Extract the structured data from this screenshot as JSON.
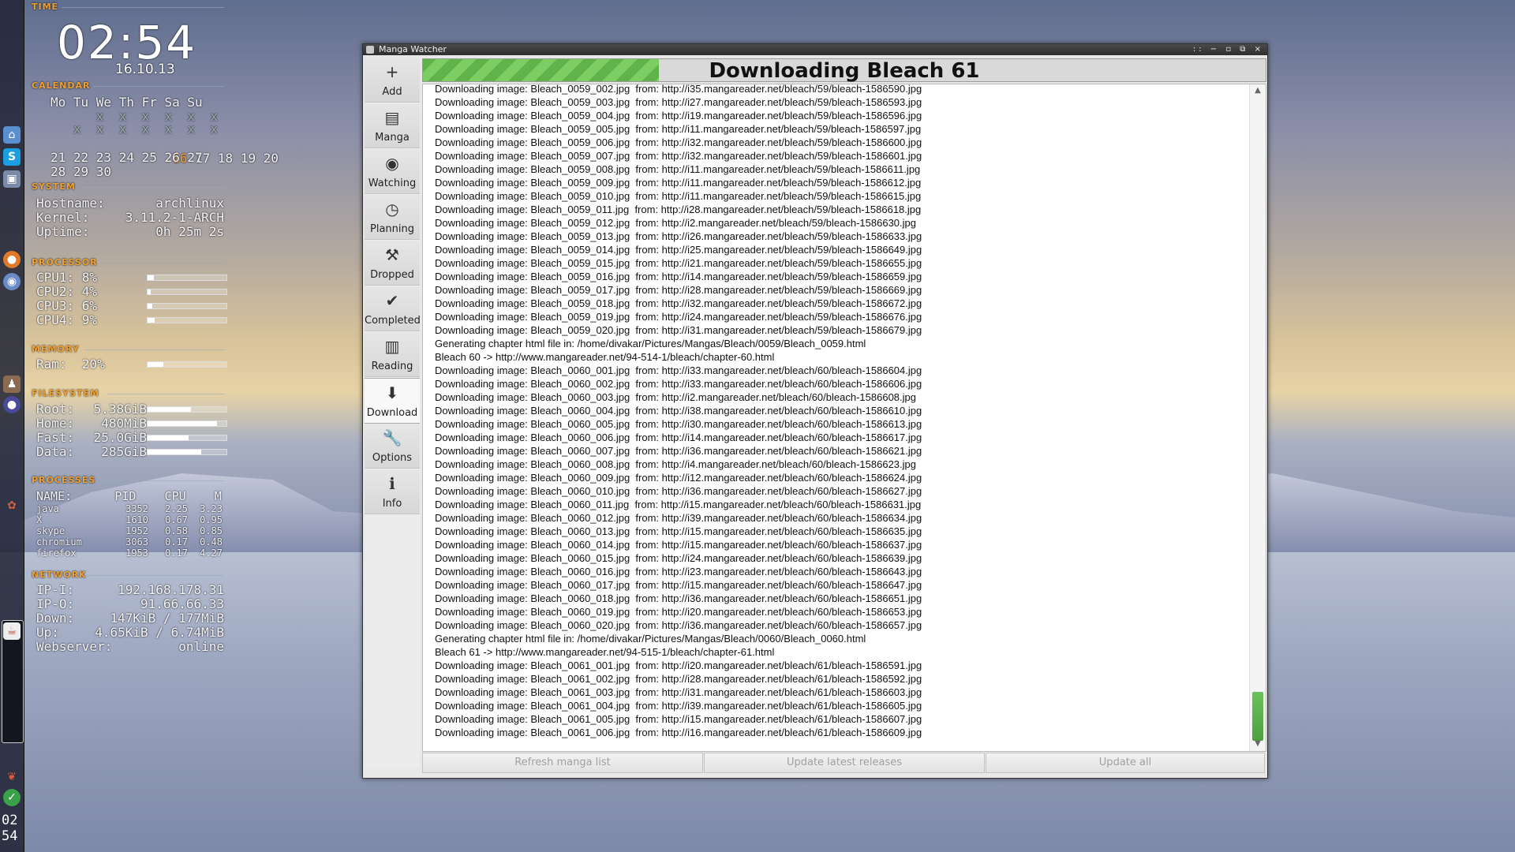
{
  "conky": {
    "time_title": "TIME",
    "clock": "02:54",
    "date": "16.10.13",
    "calendar_title": "CALENDAR",
    "calendar_header": "Mo Tu We Th Fr Sa Su",
    "calendar_rows": [
      "             16 17 18 19 20",
      "21 22 23 24 25 26 27",
      "28 29 30"
    ],
    "calendar_today": "16",
    "system_title": "SYSTEM",
    "hostname_label": "Hostname:",
    "hostname": "archlinux",
    "kernel_label": "Kernel:",
    "kernel": "3.11.2-1-ARCH",
    "uptime_label": "Uptime:",
    "uptime": "0h 25m 2s",
    "processor_title": "PROCESSOR",
    "cpus": [
      {
        "label": "CPU1: 8%",
        "pct": 8
      },
      {
        "label": "CPU2: 4%",
        "pct": 4
      },
      {
        "label": "CPU3: 6%",
        "pct": 6
      },
      {
        "label": "CPU4: 9%",
        "pct": 9
      }
    ],
    "memory_title": "MEMORY",
    "ram_label": "Ram:  20%",
    "ram_pct": 20,
    "filesystem_title": "FILESYSTEM",
    "fs": [
      {
        "label": "Root:",
        "value": "5.38GiB",
        "pct": 55
      },
      {
        "label": "Home:",
        "value": "480MiB",
        "pct": 88
      },
      {
        "label": "Fast:",
        "value": "25.0GiB",
        "pct": 52
      },
      {
        "label": "Data:",
        "value": "285GiB",
        "pct": 68
      }
    ],
    "processes_title": "PROCESSES",
    "proc_header": "NAME:      PID    CPU    M",
    "procs": [
      {
        "name": "java",
        "pid": "3352",
        "cpu": "2.25",
        "mem": "3.23"
      },
      {
        "name": "X",
        "pid": "1610",
        "cpu": "0.67",
        "mem": "0.95"
      },
      {
        "name": "skype",
        "pid": "1952",
        "cpu": "0.58",
        "mem": "0.85"
      },
      {
        "name": "chromium",
        "pid": "3063",
        "cpu": "0.17",
        "mem": "0.48"
      },
      {
        "name": "firefox",
        "pid": "1953",
        "cpu": "0.17",
        "mem": "4.27"
      }
    ],
    "network_title": "NETWORK",
    "ipi_label": "IP-I:",
    "ipi": "192.168.178.31",
    "ipo_label": "IP-O:",
    "ipo": "91.66.66.33",
    "down_label": "Down:",
    "down": "147KiB / 177MiB",
    "up_label": "Up:",
    "up": "4.65KiB / 6.74MiB",
    "web_label": "Webserver:",
    "web": "online"
  },
  "dock": {
    "clock_h": "02",
    "clock_m": "54",
    "icons": [
      "home-icon",
      "skype-icon",
      "files-icon",
      "firefox-icon",
      "chromium-icon",
      "app-icon",
      "ball-icon",
      "leaf-icon",
      "java-icon",
      "bird-icon",
      "check-icon"
    ]
  },
  "window": {
    "title": "Manga Watcher",
    "controls": ":: − ▫ ⧉ ×",
    "nav": [
      {
        "label": "Add",
        "icon": "plus-icon",
        "glyph": "+"
      },
      {
        "label": "Manga",
        "icon": "notebook-icon",
        "glyph": "▤"
      },
      {
        "label": "Watching",
        "icon": "eye-icon",
        "glyph": "◉"
      },
      {
        "label": "Planning",
        "icon": "clock-icon",
        "glyph": "◷"
      },
      {
        "label": "Dropped",
        "icon": "gavel-icon",
        "glyph": "⚒"
      },
      {
        "label": "Completed",
        "icon": "checkmark-icon",
        "glyph": "✔"
      },
      {
        "label": "Reading",
        "icon": "book-icon",
        "glyph": "▥"
      },
      {
        "label": "Download",
        "icon": "download-arrow-icon",
        "glyph": "⬇"
      },
      {
        "label": "Options",
        "icon": "wrench-icon",
        "glyph": "🔧"
      },
      {
        "label": "Info",
        "icon": "info-icon",
        "glyph": "ℹ"
      }
    ],
    "active_nav": "Download",
    "progress_text": "Downloading Bleach 61",
    "progress_fraction": 0.28,
    "log": [
      "Downloading image: Bleach_0059_002.jpg  from: http://i35.mangareader.net/bleach/59/bleach-1586590.jpg",
      "Downloading image: Bleach_0059_003.jpg  from: http://i27.mangareader.net/bleach/59/bleach-1586593.jpg",
      "Downloading image: Bleach_0059_004.jpg  from: http://i19.mangareader.net/bleach/59/bleach-1586596.jpg",
      "Downloading image: Bleach_0059_005.jpg  from: http://i11.mangareader.net/bleach/59/bleach-1586597.jpg",
      "Downloading image: Bleach_0059_006.jpg  from: http://i32.mangareader.net/bleach/59/bleach-1586600.jpg",
      "Downloading image: Bleach_0059_007.jpg  from: http://i32.mangareader.net/bleach/59/bleach-1586601.jpg",
      "Downloading image: Bleach_0059_008.jpg  from: http://i11.mangareader.net/bleach/59/bleach-1586611.jpg",
      "Downloading image: Bleach_0059_009.jpg  from: http://i11.mangareader.net/bleach/59/bleach-1586612.jpg",
      "Downloading image: Bleach_0059_010.jpg  from: http://i11.mangareader.net/bleach/59/bleach-1586615.jpg",
      "Downloading image: Bleach_0059_011.jpg  from: http://i28.mangareader.net/bleach/59/bleach-1586618.jpg",
      "Downloading image: Bleach_0059_012.jpg  from: http://i2.mangareader.net/bleach/59/bleach-1586630.jpg",
      "Downloading image: Bleach_0059_013.jpg  from: http://i26.mangareader.net/bleach/59/bleach-1586633.jpg",
      "Downloading image: Bleach_0059_014.jpg  from: http://i25.mangareader.net/bleach/59/bleach-1586649.jpg",
      "Downloading image: Bleach_0059_015.jpg  from: http://i21.mangareader.net/bleach/59/bleach-1586655.jpg",
      "Downloading image: Bleach_0059_016.jpg  from: http://i14.mangareader.net/bleach/59/bleach-1586659.jpg",
      "Downloading image: Bleach_0059_017.jpg  from: http://i28.mangareader.net/bleach/59/bleach-1586669.jpg",
      "Downloading image: Bleach_0059_018.jpg  from: http://i32.mangareader.net/bleach/59/bleach-1586672.jpg",
      "Downloading image: Bleach_0059_019.jpg  from: http://i24.mangareader.net/bleach/59/bleach-1586676.jpg",
      "Downloading image: Bleach_0059_020.jpg  from: http://i31.mangareader.net/bleach/59/bleach-1586679.jpg",
      "Generating chapter html file in: /home/divakar/Pictures/Mangas/Bleach/0059/Bleach_0059.html",
      "Bleach 60 -> http://www.mangareader.net/94-514-1/bleach/chapter-60.html",
      "Downloading image: Bleach_0060_001.jpg  from: http://i33.mangareader.net/bleach/60/bleach-1586604.jpg",
      "Downloading image: Bleach_0060_002.jpg  from: http://i33.mangareader.net/bleach/60/bleach-1586606.jpg",
      "Downloading image: Bleach_0060_003.jpg  from: http://i2.mangareader.net/bleach/60/bleach-1586608.jpg",
      "Downloading image: Bleach_0060_004.jpg  from: http://i38.mangareader.net/bleach/60/bleach-1586610.jpg",
      "Downloading image: Bleach_0060_005.jpg  from: http://i30.mangareader.net/bleach/60/bleach-1586613.jpg",
      "Downloading image: Bleach_0060_006.jpg  from: http://i14.mangareader.net/bleach/60/bleach-1586617.jpg",
      "Downloading image: Bleach_0060_007.jpg  from: http://i36.mangareader.net/bleach/60/bleach-1586621.jpg",
      "Downloading image: Bleach_0060_008.jpg  from: http://i4.mangareader.net/bleach/60/bleach-1586623.jpg",
      "Downloading image: Bleach_0060_009.jpg  from: http://i12.mangareader.net/bleach/60/bleach-1586624.jpg",
      "Downloading image: Bleach_0060_010.jpg  from: http://i36.mangareader.net/bleach/60/bleach-1586627.jpg",
      "Downloading image: Bleach_0060_011.jpg  from: http://i15.mangareader.net/bleach/60/bleach-1586631.jpg",
      "Downloading image: Bleach_0060_012.jpg  from: http://i39.mangareader.net/bleach/60/bleach-1586634.jpg",
      "Downloading image: Bleach_0060_013.jpg  from: http://i15.mangareader.net/bleach/60/bleach-1586635.jpg",
      "Downloading image: Bleach_0060_014.jpg  from: http://i15.mangareader.net/bleach/60/bleach-1586637.jpg",
      "Downloading image: Bleach_0060_015.jpg  from: http://i24.mangareader.net/bleach/60/bleach-1586639.jpg",
      "Downloading image: Bleach_0060_016.jpg  from: http://i23.mangareader.net/bleach/60/bleach-1586643.jpg",
      "Downloading image: Bleach_0060_017.jpg  from: http://i15.mangareader.net/bleach/60/bleach-1586647.jpg",
      "Downloading image: Bleach_0060_018.jpg  from: http://i36.mangareader.net/bleach/60/bleach-1586651.jpg",
      "Downloading image: Bleach_0060_019.jpg  from: http://i20.mangareader.net/bleach/60/bleach-1586653.jpg",
      "Downloading image: Bleach_0060_020.jpg  from: http://i36.mangareader.net/bleach/60/bleach-1586657.jpg",
      "Generating chapter html file in: /home/divakar/Pictures/Mangas/Bleach/0060/Bleach_0060.html",
      "Bleach 61 -> http://www.mangareader.net/94-515-1/bleach/chapter-61.html",
      "Downloading image: Bleach_0061_001.jpg  from: http://i20.mangareader.net/bleach/61/bleach-1586591.jpg",
      "Downloading image: Bleach_0061_002.jpg  from: http://i28.mangareader.net/bleach/61/bleach-1586592.jpg",
      "Downloading image: Bleach_0061_003.jpg  from: http://i31.mangareader.net/bleach/61/bleach-1586603.jpg",
      "Downloading image: Bleach_0061_004.jpg  from: http://i39.mangareader.net/bleach/61/bleach-1586605.jpg",
      "Downloading image: Bleach_0061_005.jpg  from: http://i15.mangareader.net/bleach/61/bleach-1586607.jpg",
      "Downloading image: Bleach_0061_006.jpg  from: http://i16.mangareader.net/bleach/61/bleach-1586609.jpg"
    ],
    "buttons": {
      "refresh": "Refresh manga list",
      "update_latest": "Update latest releases",
      "update_all": "Update all"
    }
  }
}
